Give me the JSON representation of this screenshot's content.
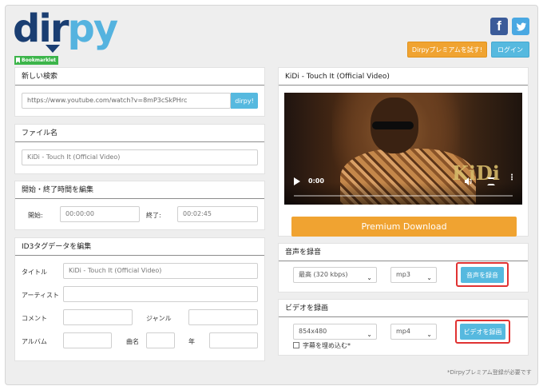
{
  "header": {
    "logo": {
      "part1": "dir",
      "part2": "py",
      "badge": "Bookmarklet"
    },
    "social": {
      "facebook": "f",
      "twitter": "twitter-bird"
    },
    "premium_button": "Dirpyプレミアムを試す!",
    "login_button": "ログイン"
  },
  "search": {
    "title": "新しい検索",
    "url": "https://www.youtube.com/watch?v=8mP3cSkPHrc",
    "button": "dirpy!"
  },
  "filename": {
    "title": "ファイル名",
    "value": "KiDi - Touch It (Official Video)"
  },
  "time_edit": {
    "title": "開始・終了時間を編集",
    "start_label": "開始:",
    "start_value": "00:00:00",
    "end_label": "終了:",
    "end_value": "00:02:45"
  },
  "id3": {
    "title": "ID3タグデータを編集",
    "title_label": "タイトル",
    "title_value": "KiDi - Touch It (Official Video)",
    "artist_label": "アーティスト",
    "artist_value": "",
    "comment_label": "コメント",
    "comment_value": "",
    "genre_label": "ジャンル",
    "genre_value": "",
    "album_label": "アルバム",
    "album_value": "",
    "track_label": "曲名",
    "track_value": "",
    "year_label": "年",
    "year_value": ""
  },
  "video": {
    "title": "KiDi - Touch It (Official Video)",
    "time": "0:00",
    "watermark": "KiDi",
    "premium_download": "Premium Download"
  },
  "audio": {
    "title": "音声を録音",
    "quality": "最高 (320 kbps)",
    "format": "mp3",
    "button": "音声を録音"
  },
  "video_record": {
    "title": "ビデオを録画",
    "resolution": "854x480",
    "format": "mp4",
    "button": "ビデオを録画",
    "subtitle_checkbox": "字幕を埋め込む*"
  },
  "footnote": "*Dirpyプレミアム登録が必要です",
  "colors": {
    "accent_blue": "#56b9df",
    "accent_orange": "#f0a331",
    "logo_dark": "#1a3e72",
    "highlight_red": "#e03232"
  }
}
